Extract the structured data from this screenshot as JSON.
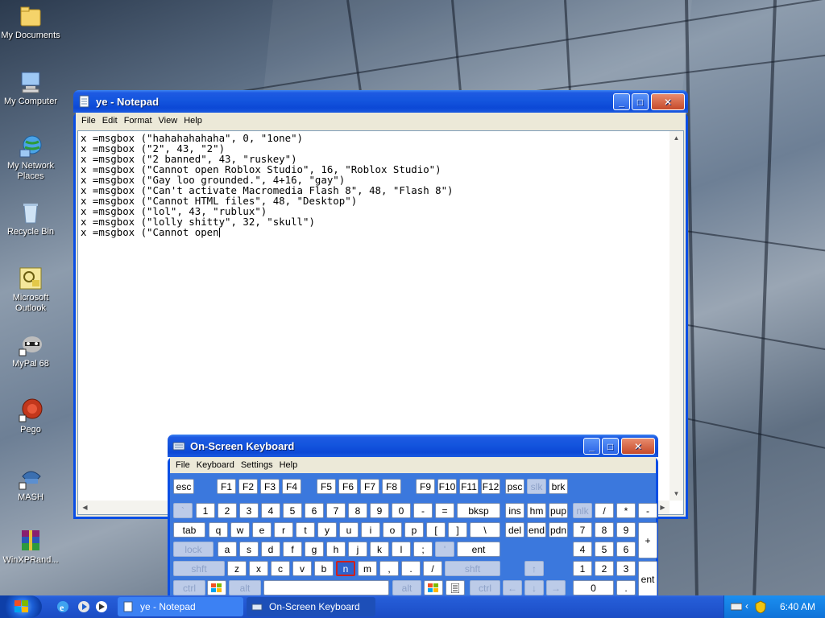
{
  "desktop": {
    "icons": [
      {
        "label": "My Documents"
      },
      {
        "label": "My Computer"
      },
      {
        "label": "My Network Places"
      },
      {
        "label": "Recycle Bin"
      },
      {
        "label": "Microsoft Outlook"
      },
      {
        "label": "MyPal 68"
      },
      {
        "label": "Pego"
      },
      {
        "label": "MASH"
      },
      {
        "label": "WinXPRand..."
      }
    ]
  },
  "notepad": {
    "title": "ye - Notepad",
    "menu": [
      "File",
      "Edit",
      "Format",
      "View",
      "Help"
    ],
    "lines": [
      "x =msgbox (\"hahahahahaha\", 0, \"1one\")",
      "x =msgbox (\"2\", 43, \"2\")",
      "x =msgbox (\"2 banned\", 43, \"ruskey\")",
      "x =msgbox (\"Cannot open Roblox Studio\", 16, \"Roblox Studio\")",
      "x =msgbox (\"Gay loo grounded.\", 4+16, \"gay\")",
      "x =msgbox (\"Can't activate Macromedia Flash 8\", 48, \"Flash 8\")",
      "x =msgbox (\"Cannot HTML files\", 48, \"Desktop\")",
      "x =msgbox (\"lol\", 43, \"rublux\")",
      "x =msgbox (\"lolly shitty\", 32, \"skull\")",
      "x =msgbox (\"Cannot open"
    ]
  },
  "osk": {
    "title": "On-Screen Keyboard",
    "menu": [
      "File",
      "Keyboard",
      "Settings",
      "Help"
    ],
    "keys": {
      "esc": "esc",
      "f1": "F1",
      "f2": "F2",
      "f3": "F3",
      "f4": "F4",
      "f5": "F5",
      "f6": "F6",
      "f7": "F7",
      "f8": "F8",
      "f9": "F9",
      "f10": "F10",
      "f11": "F11",
      "f12": "F12",
      "psc": "psc",
      "slk": "slk",
      "brk": "brk",
      "grave": "`",
      "n1": "1",
      "n2": "2",
      "n3": "3",
      "n4": "4",
      "n5": "5",
      "n6": "6",
      "n7": "7",
      "n8": "8",
      "n9": "9",
      "n0": "0",
      "minus": "-",
      "equals": "=",
      "bksp": "bksp",
      "ins": "ins",
      "hm": "hm",
      "pup": "pup",
      "nlk": "nlk",
      "kdiv": "/",
      "kmul": "*",
      "ksub": "-",
      "tab": "tab",
      "q": "q",
      "w": "w",
      "e": "e",
      "r": "r",
      "t": "t",
      "y": "y",
      "u": "u",
      "i": "i",
      "o": "o",
      "p": "p",
      "lbr": "[",
      "rbr": "]",
      "bslash": "\\",
      "del": "del",
      "end": "end",
      "pdn": "pdn",
      "k7": "7",
      "k8": "8",
      "k9": "9",
      "kadd": "+",
      "lock": "lock",
      "a": "a",
      "s": "s",
      "d": "d",
      "f": "f",
      "g": "g",
      "h": "h",
      "j": "j",
      "k": "k",
      "l": "l",
      "semi": ";",
      "quote": "'",
      "ent": "ent",
      "k4": "4",
      "k5": "5",
      "k6": "6",
      "shft_l": "shft",
      "z": "z",
      "x": "x",
      "c": "c",
      "v": "v",
      "b": "b",
      "n": "n",
      "m": "m",
      "comma": ",",
      "period": ".",
      "slash": "/",
      "shft_r": "shft",
      "k1": "1",
      "k2": "2",
      "k3": "3",
      "kent": "ent",
      "ctrl_l": "ctrl",
      "alt_l": "alt",
      "alt_r": "alt",
      "ctrl_r": "ctrl",
      "k0": "0",
      "kdot": "."
    }
  },
  "taskbar": {
    "tasks": [
      {
        "label": "ye - Notepad"
      },
      {
        "label": "On-Screen Keyboard"
      }
    ],
    "clock": "6:40 AM"
  },
  "colors": {
    "title_blue": "#0c48d6",
    "taskbar_blue": "#2156d0",
    "tray_blue": "#0f72d8",
    "highlight_key": "#d0201c"
  }
}
